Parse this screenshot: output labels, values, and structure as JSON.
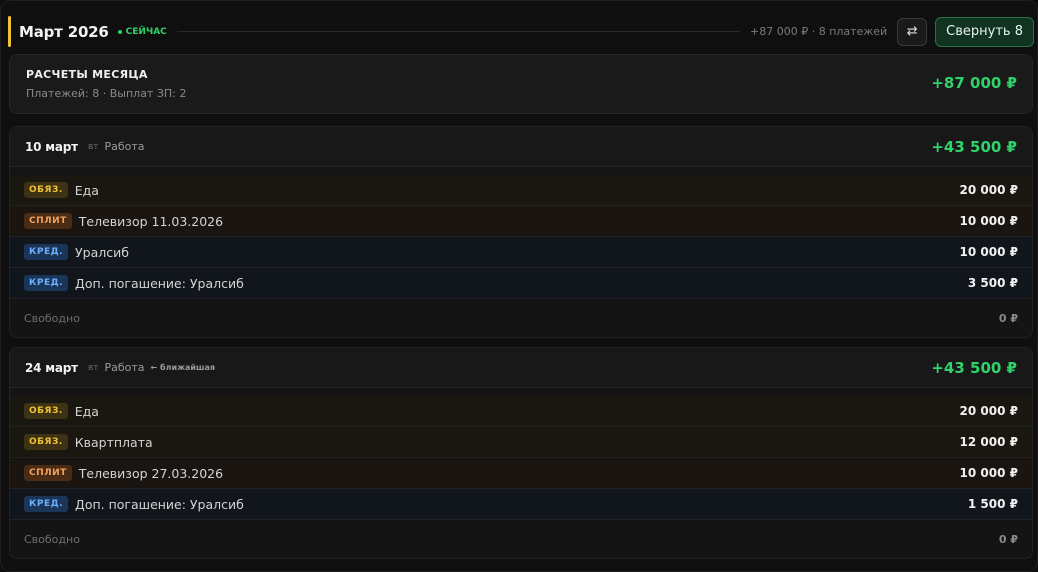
{
  "header": {
    "month": "Март 2026",
    "now_label": "СЕЙЧАС",
    "summary": "+87 000 ₽ · 8 платежей",
    "swap_icon": "⇄",
    "collapse_label": "Свернуть 8"
  },
  "summary": {
    "title": "РАСЧЕТЫ МЕСЯЦА",
    "subtitle": "Платежей: 8 · Выплат ЗП: 2",
    "total": "+87 000 ₽"
  },
  "payments": [
    {
      "date": "10 март",
      "weekday": "вт",
      "source": "Работа",
      "note": "",
      "total": "+43 500 ₽",
      "rows": [
        {
          "badge": "ОБЯЗ.",
          "type": "obyaz",
          "name": "Еда",
          "amount": "20 000 ₽"
        },
        {
          "badge": "СПЛИТ",
          "type": "split",
          "name": "Телевизор 11.03.2026",
          "amount": "10 000 ₽"
        },
        {
          "badge": "КРЕД.",
          "type": "kred",
          "name": "Уралсиб",
          "amount": "10 000 ₽"
        },
        {
          "badge": "КРЕД.",
          "type": "kred",
          "name": "Доп. погашение: Уралсиб",
          "amount": "3 500 ₽"
        }
      ],
      "free_label": "Свободно",
      "free_amount": "0 ₽"
    },
    {
      "date": "24 март",
      "weekday": "вт",
      "source": "Работа",
      "note": "← ближайшая",
      "total": "+43 500 ₽",
      "rows": [
        {
          "badge": "ОБЯЗ.",
          "type": "obyaz",
          "name": "Еда",
          "amount": "20 000 ₽"
        },
        {
          "badge": "ОБЯЗ.",
          "type": "obyaz",
          "name": "Квартплата",
          "amount": "12 000 ₽"
        },
        {
          "badge": "СПЛИТ",
          "type": "split",
          "name": "Телевизор 27.03.2026",
          "amount": "10 000 ₽"
        },
        {
          "badge": "КРЕД.",
          "type": "kred",
          "name": "Доп. погашение: Уралсиб",
          "amount": "1 500 ₽"
        }
      ],
      "free_label": "Свободно",
      "free_amount": "0 ₽"
    }
  ],
  "colors": {
    "accent": "#f1c232",
    "positive": "#2fd36a",
    "obyaz": "#f1c232",
    "split": "#f2a35e",
    "kred": "#6ab0ff"
  }
}
